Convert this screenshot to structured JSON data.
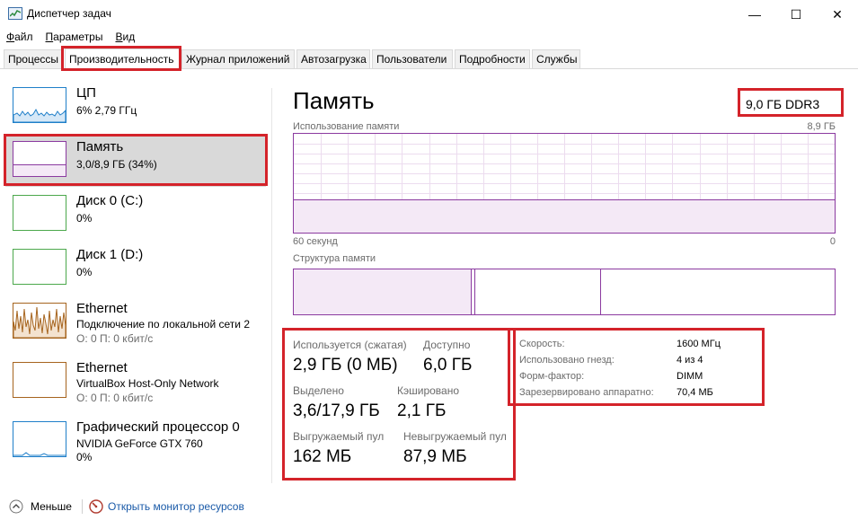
{
  "window": {
    "title": "Диспетчер задач",
    "controls": {
      "minimize": "—",
      "maximize": "☐",
      "close": "✕"
    }
  },
  "menu": [
    {
      "label": "Файл",
      "underline": "Ф",
      "rest": "айл"
    },
    {
      "label": "Параметры",
      "underline": "П",
      "rest": "араметры"
    },
    {
      "label": "Вид",
      "underline": "В",
      "rest": "ид"
    }
  ],
  "tabs": [
    "Процессы",
    "Производительность",
    "Журнал приложений",
    "Автозагрузка",
    "Пользователи",
    "Подробности",
    "Службы"
  ],
  "active_tab": "Производительность",
  "resources": [
    {
      "name": "ЦП",
      "line1": "6% 2,79 ГГц",
      "line2": ""
    },
    {
      "name": "Память",
      "line1": "3,0/8,9 ГБ (34%)",
      "line2": ""
    },
    {
      "name": "Диск 0 (C:)",
      "line1": "0%",
      "line2": ""
    },
    {
      "name": "Диск 1 (D:)",
      "line1": "0%",
      "line2": ""
    },
    {
      "name": "Ethernet",
      "line1": "Подключение по локальной сети 2",
      "line2": "О: 0 П: 0 кбит/с"
    },
    {
      "name": "Ethernet",
      "line1": "VirtualBox Host-Only Network",
      "line2": "О: 0 П: 0 кбит/с"
    },
    {
      "name": "Графический процессор 0",
      "line1": "NVIDIA GeForce GTX 760",
      "line2": "0%"
    }
  ],
  "memory": {
    "title": "Память",
    "total": "9,0 ГБ DDR3",
    "usage_label": "Использование памяти",
    "usage_max": "8,9 ГБ",
    "time_left": "60 секунд",
    "time_right": "0",
    "usage_fraction": 0.34,
    "composition_label": "Структура памяти",
    "stats": {
      "in_use_label": "Используется (сжатая)",
      "in_use_value": "2,9 ГБ (0 МБ)",
      "available_label": "Доступно",
      "available_value": "6,0 ГБ",
      "committed_label": "Выделено",
      "committed_value": "3,6/17,9 ГБ",
      "cached_label": "Кэшировано",
      "cached_value": "2,1 ГБ",
      "paged_label": "Выгружаемый пул",
      "paged_value": "162 МБ",
      "nonpaged_label": "Невыгружаемый пул",
      "nonpaged_value": "87,9 МБ"
    },
    "props": [
      {
        "label": "Скорость:",
        "value": "1600 МГц"
      },
      {
        "label": "Использовано гнезд:",
        "value": "4 из 4"
      },
      {
        "label": "Форм-фактор:",
        "value": "DIMM"
      },
      {
        "label": "Зарезервировано аппаратно:",
        "value": "70,4 МБ"
      }
    ]
  },
  "footer": {
    "fewer_details": "Меньше",
    "open_monitor": "Открыть монитор ресурсов"
  },
  "colors": {
    "memory_accent": "#8b3aa0",
    "memory_fill": "#f4e9f6",
    "cpu_accent": "#1f7fc9",
    "disk_accent": "#4ca84c",
    "ethernet_accent": "#a6641e",
    "highlight_red": "#d4232a",
    "link_blue": "#1a5aa8"
  }
}
